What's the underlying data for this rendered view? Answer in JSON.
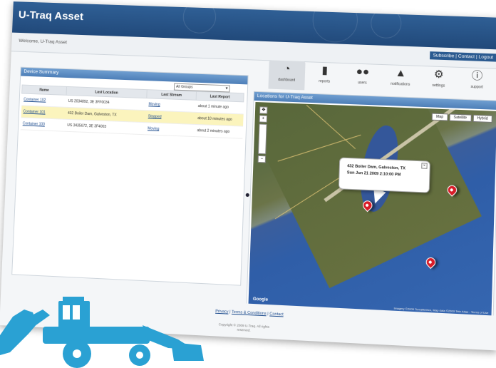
{
  "app": {
    "title": "U-Traq Asset",
    "welcome": "Welcome, U-Traq Asset"
  },
  "top_links": {
    "text": "Subscribe | Contact | Logout"
  },
  "nav": [
    {
      "label": "dashboard",
      "icon": "gauge-icon",
      "active": true
    },
    {
      "label": "reports",
      "icon": "document-icon"
    },
    {
      "label": "users",
      "icon": "users-icon"
    },
    {
      "label": "notifications",
      "icon": "warning-icon"
    },
    {
      "label": "settings",
      "icon": "gears-icon"
    },
    {
      "label": "support",
      "icon": "info-icon"
    }
  ],
  "device_summary": {
    "title": "Device Summary",
    "group_select": "All Groups",
    "columns": [
      "Name",
      "Last Location",
      "Last Stream",
      "Last Report"
    ],
    "rows": [
      {
        "name": "Container 102",
        "location": "US 2034892, 3E 3FF0034",
        "stream": "Moving",
        "report": "about 1 minute ago",
        "highlight": false
      },
      {
        "name": "Container 101",
        "location": "432 Boiler Dam, Galveston, TX",
        "stream": "Stopped",
        "report": "about 10 minutes ago",
        "highlight": true
      },
      {
        "name": "Container 100",
        "location": "US 3435672, 3E 3F4003",
        "stream": "Moving",
        "report": "about 2 minutes ago",
        "highlight": false
      }
    ]
  },
  "map_panel": {
    "title": "Locations for U-Traq Asset",
    "map_types": [
      "Map",
      "Satellite",
      "Hybrid"
    ],
    "bubble_line1": "432 Boiler Dam, Galveston, TX",
    "bubble_line2": "Sun Jun 21 2009 2:10:00 PM",
    "credit": "Imagery ©2009 TerraMetrics, Map data ©2009 Tele Atlas - Terms of Use",
    "logo": "Google"
  },
  "footer": {
    "privacy": "Privacy",
    "terms": "Terms & Conditions",
    "contact": "Contact",
    "copyright": "Copyright © 2009 U-Traq. All rights reserved."
  },
  "colors": {
    "header": "#2f5f95",
    "panel_head": "#5b8cc4",
    "highlight_row": "#fbf4bd",
    "backhoe": "#2aa1d3",
    "pin": "#d81c28"
  }
}
